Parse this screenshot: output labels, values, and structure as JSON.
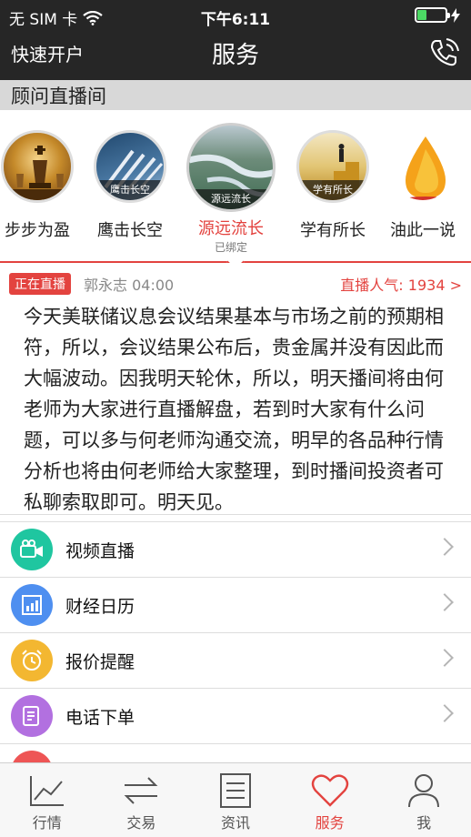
{
  "status_bar": {
    "carrier": "无 SIM 卡",
    "time": "下午6:11"
  },
  "nav": {
    "left_label": "快速开户",
    "title": "服务"
  },
  "section_title": "顾问直播间",
  "advisors": [
    {
      "name": "步步为盈",
      "caption": "",
      "sub": ""
    },
    {
      "name": "鹰击长空",
      "caption": "鹰击长空",
      "sub": ""
    },
    {
      "name": "源远流长",
      "caption": "源远流长",
      "sub": "已绑定"
    },
    {
      "name": "学有所长",
      "caption": "学有所长",
      "sub": ""
    },
    {
      "name": "油此一说",
      "caption": "",
      "sub": ""
    }
  ],
  "live": {
    "badge": "正在直播",
    "host": "郭永志 04:00",
    "popularity": "直播人气: 1934 >",
    "message": "今天美联储议息会议结果基本与市场之前的预期相符，所以，会议结果公布后，贵金属并没有因此而大幅波动。因我明天轮休，所以，明天播间将由何老师为大家进行直播解盘，若到时大家有什么问题，可以多与何老师沟通交流，明早的各品种行情分析也将由何老师给大家整理，到时播间投资者可私聊索取即可。明天见。"
  },
  "menu": [
    {
      "label": "视频直播",
      "icon": "video-camera-icon",
      "color": "#1fc6a0"
    },
    {
      "label": "财经日历",
      "icon": "chart-calendar-icon",
      "color": "#4e8ff0"
    },
    {
      "label": "报价提醒",
      "icon": "alarm-clock-icon",
      "color": "#f3b731"
    },
    {
      "label": "电话下单",
      "icon": "document-icon",
      "color": "#b270e0"
    }
  ],
  "tabs": [
    {
      "label": "行情",
      "icon": "trend-chart-icon",
      "active": false
    },
    {
      "label": "交易",
      "icon": "exchange-arrows-icon",
      "active": false
    },
    {
      "label": "资讯",
      "icon": "news-document-icon",
      "active": false
    },
    {
      "label": "服务",
      "icon": "heart-icon",
      "active": true
    },
    {
      "label": "我",
      "icon": "person-icon",
      "active": false
    }
  ],
  "colors": {
    "accent": "#e3433f",
    "topbar": "#262626",
    "battery": "#4cd964"
  }
}
